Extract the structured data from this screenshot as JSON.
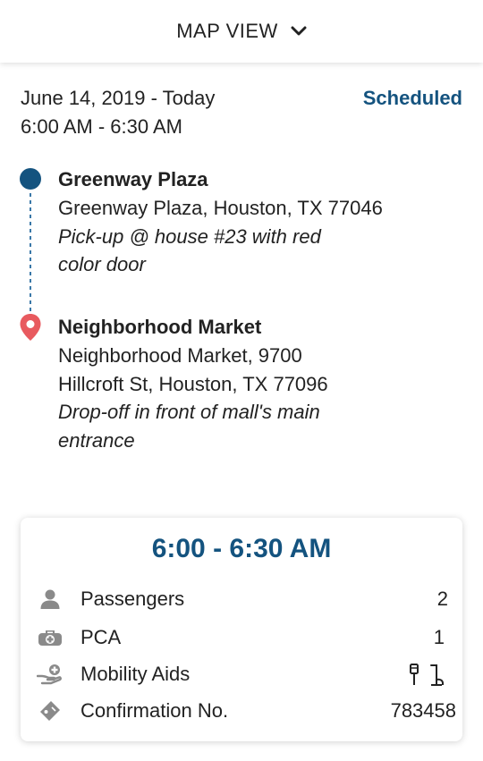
{
  "header": {
    "title": "MAP VIEW",
    "dropdown_icon": "chevron-down-icon"
  },
  "trip": {
    "date": "June 14, 2019 - Today",
    "time": "6:00 AM - 6:30 AM",
    "status": "Scheduled",
    "status_color": "#14537f"
  },
  "pickup": {
    "name": "Greenway Plaza",
    "address": "Greenway Plaza, Houston, TX 77046",
    "note_line1": "Pick-up @ house #23 with red",
    "note_line2": "color door",
    "marker_color": "#14537f"
  },
  "dropoff": {
    "name": "Neighborhood Market",
    "address_line1": "Neighborhood Market, 9700",
    "address_line2": "Hillcroft St, Houston, TX 77096",
    "note_line1": "Drop-off in front of mall's main",
    "note_line2": "entrance",
    "marker_color": "#e85a5f"
  },
  "summary": {
    "time_range": "6:00 - 6:30 AM",
    "passengers_label": "Passengers",
    "passengers_value": "2",
    "pca_label": "PCA",
    "pca_value": "1",
    "mobility_label": "Mobility Aids",
    "mobility_icons": [
      "cane-icon",
      "walker-icon"
    ],
    "confirmation_label": "Confirmation No.",
    "confirmation_value": "783458"
  },
  "colors": {
    "accent": "#14537f",
    "pin": "#e85a5f",
    "icon_gray": "#8a8a8a"
  }
}
